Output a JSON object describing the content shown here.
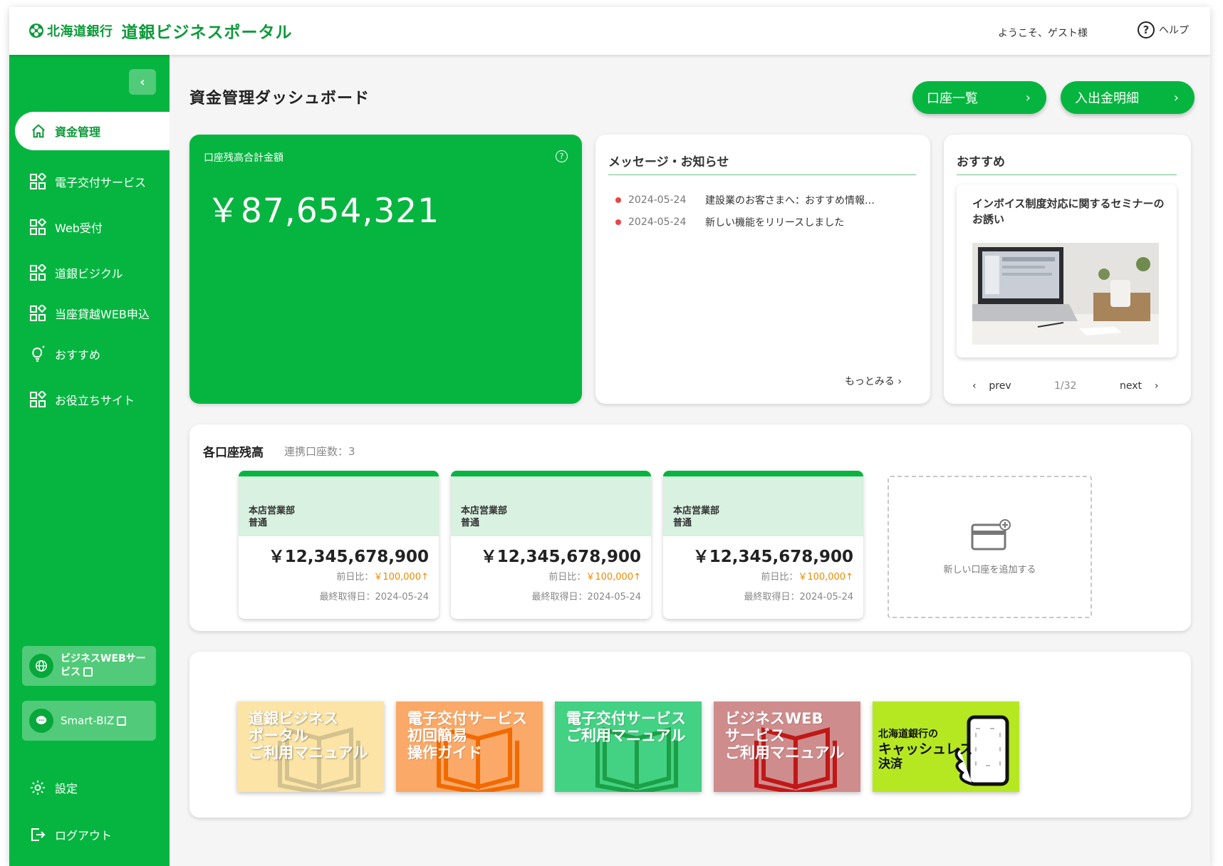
{
  "header": {
    "bank_name": "北海道銀行",
    "portal_name": "道銀ビジネスポータル",
    "welcome": "ようこそ、ゲスト様",
    "help_label": "ヘルプ"
  },
  "sidebar": {
    "collapse_icon": "chevron-left-icon",
    "active_item": "資金管理",
    "items": [
      {
        "label": "電子交付サービス",
        "icon": "apps-grid-icon"
      },
      {
        "label": "Web受付",
        "icon": "apps-grid-icon"
      },
      {
        "label": "道銀ビジクル",
        "icon": "apps-grid-icon"
      },
      {
        "label": "当座貸越WEB申込",
        "icon": "apps-grid-icon"
      },
      {
        "label": "おすすめ",
        "icon": "lightbulb-icon"
      },
      {
        "label": "お役立ちサイト",
        "icon": "apps-grid-icon"
      }
    ],
    "business_web": "ビジネスWEBサービス",
    "business_web_line1": "ビジネスWEBサー",
    "business_web_line2": "ビス",
    "smart_biz": "Smart-BIZ",
    "settings": "設定",
    "logout": "ログアウト"
  },
  "main": {
    "title": "資金管理ダッシュボード",
    "btn_accounts": "口座一覧",
    "btn_transactions": "入出金明細",
    "balance_label": "口座残高合計金額",
    "balance_total": "￥87,654,321",
    "messages": {
      "title": "メッセージ・お知らせ",
      "items": [
        {
          "date": "2024-05-24",
          "text": "建設業のお客さまへ：おすすめ情報…"
        },
        {
          "date": "2024-05-24",
          "text": "新しい機能をリリースしました"
        }
      ],
      "more": "もっとみる"
    },
    "recommend": {
      "title": "おすすめ",
      "card_title": "インボイス制度対応に関するセミナーのお誘い",
      "prev": "prev",
      "next": "next",
      "page": "1/32"
    },
    "accounts": {
      "title": "各口座残高",
      "linked": "連携口座数：3",
      "items": [
        {
          "branch": "本店営業部",
          "type": "普通",
          "balance": "￥12,345,678,900",
          "diff_label": "前日比：",
          "diff": "￥100,000",
          "updated": "最終取得日：2024-05-24"
        },
        {
          "branch": "本店営業部",
          "type": "普通",
          "balance": "￥12,345,678,900",
          "diff_label": "前日比：",
          "diff": "￥100,000",
          "updated": "最終取得日：2024-05-24"
        },
        {
          "branch": "本店営業部",
          "type": "普通",
          "balance": "￥12,345,678,900",
          "diff_label": "前日比：",
          "diff": "￥100,000",
          "updated": "最終取得日：2024-05-24"
        }
      ],
      "add": "新しい口座を追加する"
    },
    "manuals": [
      {
        "line1": "道銀ビジネス",
        "line2": "ポータル",
        "line3": "ご利用マニュアル",
        "color": "#fbe4a6",
        "accent": "#c9b98a"
      },
      {
        "line1": "電子交付サービス",
        "line2": "初回簡易",
        "line3": "操作ガイド",
        "color": "#fba968",
        "accent": "#f06a00"
      },
      {
        "line1": "電子交付サービス",
        "line2": "ご利用マニュアル",
        "line3": "",
        "color": "#43d183",
        "accent": "#1ca047"
      },
      {
        "line1": "ビジネスWEB",
        "line2": "サービス",
        "line3": "ご利用マニュアル",
        "color": "#cf8c8c",
        "accent": "#c01818"
      },
      {
        "line1": "北海道銀行の",
        "line2": "キャッシュレス",
        "line3": "決済",
        "color": "#b6e822",
        "accent": "#111111"
      }
    ]
  }
}
